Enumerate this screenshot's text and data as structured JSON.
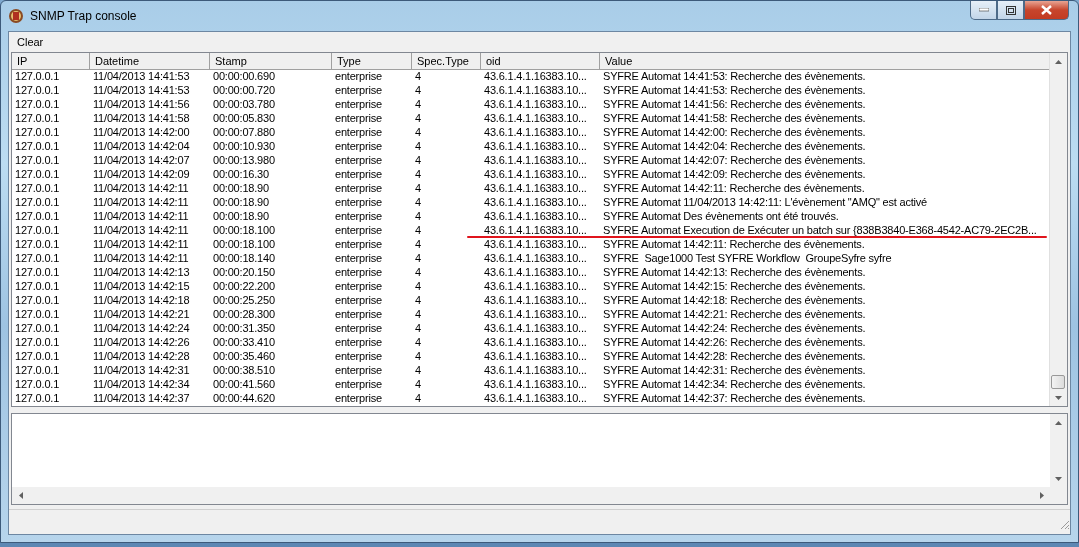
{
  "window": {
    "title": "SNMP Trap console"
  },
  "menu": [
    {
      "label": "Clear"
    }
  ],
  "table": {
    "columns": [
      "IP",
      "Datetime",
      "Stamp",
      "Type",
      "Spec.Type",
      "oid",
      "Value"
    ],
    "rows": [
      [
        "127.0.0.1",
        "11/04/2013 14:41:53",
        "00:00:00.690",
        "enterprise",
        "4",
        "43.6.1.4.1.16383.10...",
        "SYFRE Automat 14:41:53: Recherche des évènements."
      ],
      [
        "127.0.0.1",
        "11/04/2013 14:41:53",
        "00:00:00.720",
        "enterprise",
        "4",
        "43.6.1.4.1.16383.10...",
        "SYFRE Automat 14:41:53: Recherche des évènements."
      ],
      [
        "127.0.0.1",
        "11/04/2013 14:41:56",
        "00:00:03.780",
        "enterprise",
        "4",
        "43.6.1.4.1.16383.10...",
        "SYFRE Automat 14:41:56: Recherche des évènements."
      ],
      [
        "127.0.0.1",
        "11/04/2013 14:41:58",
        "00:00:05.830",
        "enterprise",
        "4",
        "43.6.1.4.1.16383.10...",
        "SYFRE Automat 14:41:58: Recherche des évènements."
      ],
      [
        "127.0.0.1",
        "11/04/2013 14:42:00",
        "00:00:07.880",
        "enterprise",
        "4",
        "43.6.1.4.1.16383.10...",
        "SYFRE Automat 14:42:00: Recherche des évènements."
      ],
      [
        "127.0.0.1",
        "11/04/2013 14:42:04",
        "00:00:10.930",
        "enterprise",
        "4",
        "43.6.1.4.1.16383.10...",
        "SYFRE Automat 14:42:04: Recherche des évènements."
      ],
      [
        "127.0.0.1",
        "11/04/2013 14:42:07",
        "00:00:13.980",
        "enterprise",
        "4",
        "43.6.1.4.1.16383.10...",
        "SYFRE Automat 14:42:07: Recherche des évènements."
      ],
      [
        "127.0.0.1",
        "11/04/2013 14:42:09",
        "00:00:16.30",
        "enterprise",
        "4",
        "43.6.1.4.1.16383.10...",
        "SYFRE Automat 14:42:09: Recherche des évènements."
      ],
      [
        "127.0.0.1",
        "11/04/2013 14:42:11",
        "00:00:18.90",
        "enterprise",
        "4",
        "43.6.1.4.1.16383.10...",
        "SYFRE Automat 14:42:11: Recherche des évènements."
      ],
      [
        "127.0.0.1",
        "11/04/2013 14:42:11",
        "00:00:18.90",
        "enterprise",
        "4",
        "43.6.1.4.1.16383.10...",
        "SYFRE Automat 11/04/2013 14:42:11: L'évènement \"AMQ\" est activé"
      ],
      [
        "127.0.0.1",
        "11/04/2013 14:42:11",
        "00:00:18.90",
        "enterprise",
        "4",
        "43.6.1.4.1.16383.10...",
        "SYFRE Automat Des évènements ont été trouvés."
      ],
      [
        "127.0.0.1",
        "11/04/2013 14:42:11",
        "00:00:18.100",
        "enterprise",
        "4",
        "43.6.1.4.1.16383.10...",
        "SYFRE Automat Execution de Exécuter un batch sur {838B3840-E368-4542-AC79-2EC2B..."
      ],
      [
        "127.0.0.1",
        "11/04/2013 14:42:11",
        "00:00:18.100",
        "enterprise",
        "4",
        "43.6.1.4.1.16383.10...",
        "SYFRE Automat 14:42:11: Recherche des évènements."
      ],
      [
        "127.0.0.1",
        "11/04/2013 14:42:11",
        "00:00:18.140",
        "enterprise",
        "4",
        "43.6.1.4.1.16383.10...",
        "SYFRE  Sage1000 Test SYFRE Workflow  GroupeSyfre syfre"
      ],
      [
        "127.0.0.1",
        "11/04/2013 14:42:13",
        "00:00:20.150",
        "enterprise",
        "4",
        "43.6.1.4.1.16383.10...",
        "SYFRE Automat 14:42:13: Recherche des évènements."
      ],
      [
        "127.0.0.1",
        "11/04/2013 14:42:15",
        "00:00:22.200",
        "enterprise",
        "4",
        "43.6.1.4.1.16383.10...",
        "SYFRE Automat 14:42:15: Recherche des évènements."
      ],
      [
        "127.0.0.1",
        "11/04/2013 14:42:18",
        "00:00:25.250",
        "enterprise",
        "4",
        "43.6.1.4.1.16383.10...",
        "SYFRE Automat 14:42:18: Recherche des évènements."
      ],
      [
        "127.0.0.1",
        "11/04/2013 14:42:21",
        "00:00:28.300",
        "enterprise",
        "4",
        "43.6.1.4.1.16383.10...",
        "SYFRE Automat 14:42:21: Recherche des évènements."
      ],
      [
        "127.0.0.1",
        "11/04/2013 14:42:24",
        "00:00:31.350",
        "enterprise",
        "4",
        "43.6.1.4.1.16383.10...",
        "SYFRE Automat 14:42:24: Recherche des évènements."
      ],
      [
        "127.0.0.1",
        "11/04/2013 14:42:26",
        "00:00:33.410",
        "enterprise",
        "4",
        "43.6.1.4.1.16383.10...",
        "SYFRE Automat 14:42:26: Recherche des évènements."
      ],
      [
        "127.0.0.1",
        "11/04/2013 14:42:28",
        "00:00:35.460",
        "enterprise",
        "4",
        "43.6.1.4.1.16383.10...",
        "SYFRE Automat 14:42:28: Recherche des évènements."
      ],
      [
        "127.0.0.1",
        "11/04/2013 14:42:31",
        "00:00:38.510",
        "enterprise",
        "4",
        "43.6.1.4.1.16383.10...",
        "SYFRE Automat 14:42:31: Recherche des évènements."
      ],
      [
        "127.0.0.1",
        "11/04/2013 14:42:34",
        "00:00:41.560",
        "enterprise",
        "4",
        "43.6.1.4.1.16383.10...",
        "SYFRE Automat 14:42:34: Recherche des évènements."
      ],
      [
        "127.0.0.1",
        "11/04/2013 14:42:37",
        "00:00:44.620",
        "enterprise",
        "4",
        "43.6.1.4.1.16383.10...",
        "SYFRE Automat 14:42:37: Recherche des évènements."
      ]
    ]
  }
}
